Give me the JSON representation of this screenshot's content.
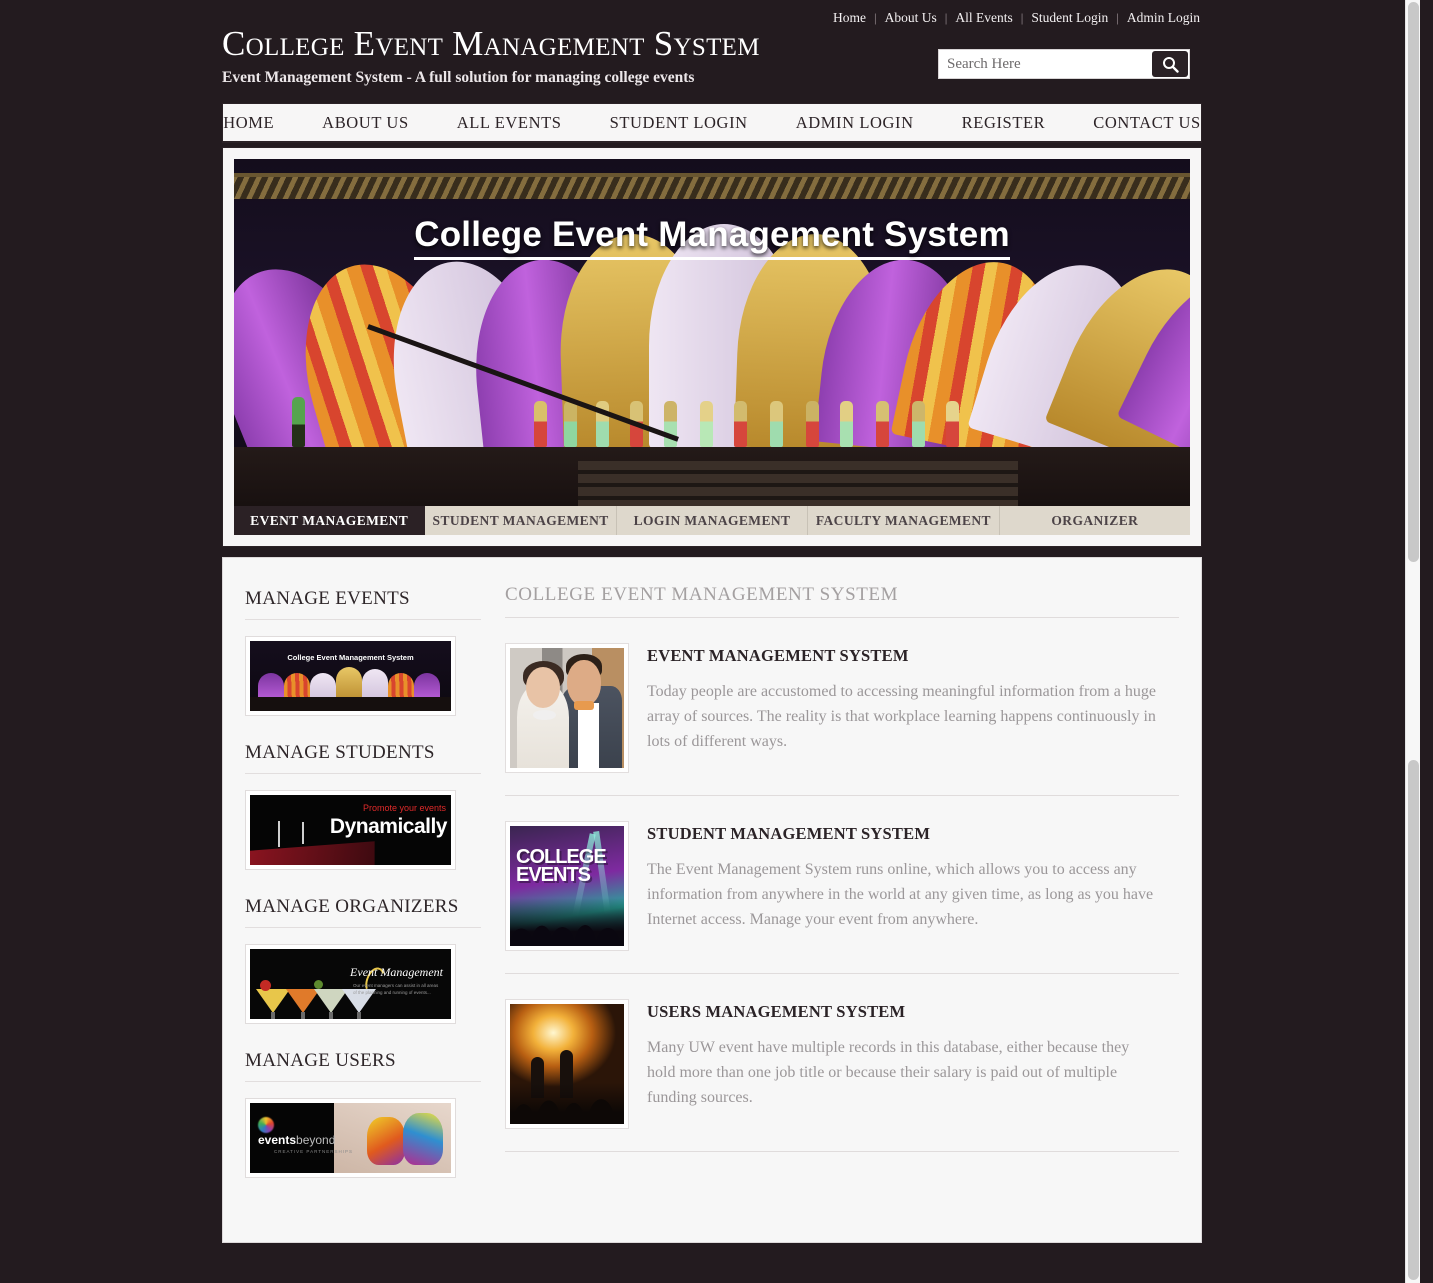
{
  "topbar": {
    "links": [
      "Home",
      "About Us",
      "All Events",
      "Student Login",
      "Admin Login"
    ],
    "separator": "|"
  },
  "brand": {
    "title": "College Event Management System",
    "tagline": "Event Management System - A full solution for managing college events"
  },
  "search": {
    "placeholder": "Search Here",
    "value": "",
    "icon": "search-icon"
  },
  "mainnav": {
    "items": [
      "HOME",
      "ABOUT US",
      "ALL EVENTS",
      "STUDENT LOGIN",
      "ADMIN LOGIN",
      "REGISTER",
      "CONTACT US"
    ]
  },
  "hero": {
    "overlay_title": "College Event Management System",
    "tabs": [
      {
        "label": "EVENT MANAGEMENT",
        "active": true
      },
      {
        "label": "STUDENT MANAGEMENT",
        "active": false
      },
      {
        "label": "LOGIN MANAGEMENT",
        "active": false
      },
      {
        "label": "FACULTY MANAGEMENT",
        "active": false
      },
      {
        "label": "ORGANIZER",
        "active": false
      }
    ]
  },
  "sidebar": {
    "sections": [
      {
        "heading": "MANAGE EVENTS",
        "image_alt": "College Event Management System stage banner",
        "image_caption": "College Event Management System"
      },
      {
        "heading": "MANAGE STUDENTS",
        "image_alt": "Promote your events Dynamically banner",
        "promote_text": "Promote your events",
        "dynamic_text": "Dynamically"
      },
      {
        "heading": "MANAGE ORGANIZERS",
        "image_alt": "Event Management cocktails banner",
        "script_text": "Event Management",
        "sub_text": "Our event managers can assist in all areas of the planning and running of events..."
      },
      {
        "heading": "MANAGE USERS",
        "image_alt": "eventsbeyond painted hands banner",
        "logo_bold": "events",
        "logo_light": "beyond",
        "logo_sub": "CREATIVE PARTNERSHIPS"
      }
    ]
  },
  "main": {
    "title": "COLLEGE EVENT MANAGEMENT SYSTEM",
    "articles": [
      {
        "title": "EVENT MANAGEMENT SYSTEM",
        "text": "Today people are accustomed to accessing meaningful information from a huge array of sources. The reality is that workplace learning happens continuously in lots of different ways.",
        "image_alt": "Bride and groom wedding photo"
      },
      {
        "title": "STUDENT MANAGEMENT SYSTEM",
        "text": "The Event Management System runs online, which allows you to access any information from anywhere in the world at any given time, as long as you have Internet access. Manage your event from anywhere.",
        "image_alt": "College Events concert poster",
        "poster_line1": "COLLEGE",
        "poster_line2": "EVENTS"
      },
      {
        "title": "USERS MANAGEMENT SYSTEM",
        "text": "Many UW event have multiple records in this database, either because they hold more than one job title or because their salary is paid out of multiple funding sources.",
        "image_alt": "Concert crowd with raised hands"
      }
    ]
  },
  "colors": {
    "page_background": "#231b1f",
    "panel_background": "#f7f7f7",
    "accent_dark": "#2b2125",
    "tab_inactive": "#ded8cc",
    "muted_text": "#9b9799"
  }
}
